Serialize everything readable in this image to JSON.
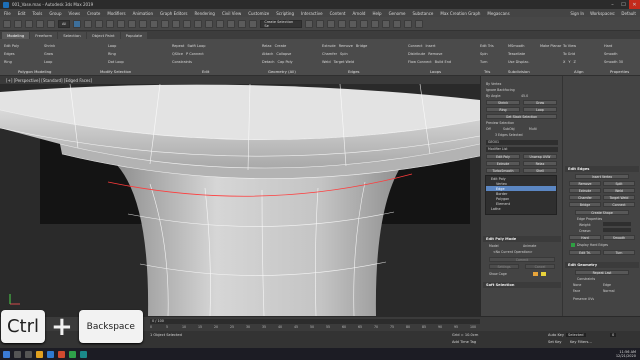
{
  "window": {
    "title": "001_Vase.max - Autodesk 3ds Max 2019",
    "min": "–",
    "max": "☐",
    "close": "✕"
  },
  "menu": {
    "items": [
      "File",
      "Edit",
      "Tools",
      "Group",
      "Views",
      "Create",
      "Modifiers",
      "Animation",
      "Graph Editors",
      "Rendering",
      "Civil View",
      "Customize",
      "Scripting",
      "Interactive",
      "Content",
      "Arnold",
      "Help",
      "Genome",
      "Substance",
      "Max Creation Graph",
      "Megascans"
    ],
    "signin": "Sign In",
    "workspaces": "Workspaces:",
    "workspace": "Default"
  },
  "toolbar": {
    "view_dd": "All",
    "create_selection_set": "Create Selection Se"
  },
  "ribbon": {
    "tabs": [
      "Modeling",
      "Freeform",
      "Selection",
      "Object Paint",
      "Populate"
    ],
    "groups": {
      "polygon_modeling": {
        "items": [
          "Edit Poly",
          "Edges",
          "Ring",
          "Loop",
          "Shrink",
          "Grow"
        ],
        "label": "Polygon Modeling"
      },
      "modify_selection": {
        "items": [
          "Loop",
          "Ring",
          "Dot Loop",
          "Ring Loop"
        ],
        "label": "Modify Selection"
      },
      "edit": {
        "items": [
          "Repeat",
          "QSlice",
          "Swift Loop",
          "Cut",
          "P Connect",
          "NURMS",
          "Constraints"
        ],
        "label": "Edit"
      },
      "geometry": {
        "items": [
          "Relax",
          "Create",
          "Attach",
          "Collapse",
          "Detach",
          "Cap Poly",
          "Quadify All"
        ],
        "label": "Geometry (All)"
      },
      "edges": {
        "items": [
          "Extrude",
          "Remove",
          "Bridge",
          "Chamfer",
          "Spin",
          "Weld",
          "Target Weld"
        ],
        "label": "Edges"
      },
      "loops": {
        "items": [
          "Connect",
          "Insert",
          "Distribute",
          "Remove",
          "Flow Connect",
          "Build End",
          "Build Corner"
        ],
        "label": "Loops"
      },
      "tris": {
        "items": [
          "Edit Tris",
          "Spin",
          "Turn"
        ],
        "label": "Tris"
      },
      "subdivision": {
        "items": [
          "MSmooth",
          "Tessellate",
          "Use Displac."
        ],
        "label": "Subdivision"
      },
      "make_planar": "Make Planar",
      "align": {
        "items": [
          "To View",
          "To Grid",
          "X",
          "Y",
          "Z"
        ],
        "label": "Align"
      },
      "properties": {
        "items": [
          "Hard",
          "Smooth",
          "Smooth 30"
        ],
        "label": "Properties"
      }
    }
  },
  "viewport": {
    "label": "[+] [Perspective] [Standard] [Edged Faces]"
  },
  "modifier_panel": {
    "sphere_backfacing": "Ignore Backfacing",
    "by_vertex": "By Vertex",
    "by_angle": "By Angle:",
    "angle_value": "45.0",
    "shrink": "Shrink",
    "grow": "Grow",
    "ring": "Ring",
    "loop": "Loop",
    "get_stack_selection": "Get Stack Selection",
    "preview_selection": "Preview Selection",
    "off": "Off",
    "subobj": "SubObj",
    "multi": "Multi",
    "edges_selected": "3 Edges Selected",
    "name": "GEO01",
    "modifier_list": "Modifier List",
    "mods": [
      "Edit Poly",
      "Extrude",
      "TurboSmooth",
      "Chamfer",
      "UVW Map",
      "Normal",
      "FFD 2x2x2"
    ],
    "mods2": [
      "Unwrap UVW",
      "Relax",
      "Shell",
      "Symmetry",
      "FFD Box",
      "Slice"
    ],
    "stack": [
      "Edit Poly",
      "Vertex",
      "Edge",
      "Border",
      "Polygon",
      "Element",
      "Lathe"
    ],
    "edit_poly_mode": "Edit Poly Mode",
    "model": "Model",
    "animate": "Animate",
    "no_current_op": "<No Current Operation>",
    "commit": "Commit",
    "settings": "Settings",
    "cancel": "Cancel",
    "show_cage": "Show Cage",
    "soft_selection": "Soft Selection"
  },
  "edit_edges": {
    "header": "Edit Edges",
    "insert_vertex": "Insert Vertex",
    "remove": "Remove",
    "split": "Split",
    "extrude": "Extrude",
    "weld": "Weld",
    "chamfer": "Chamfer",
    "target_weld": "Target Weld",
    "bridge": "Bridge",
    "connect": "Connect",
    "create_shape": "Create Shape",
    "edge_properties": "Edge Properties",
    "weight": "Weight:",
    "crease": "Crease:",
    "hard": "Hard",
    "smooth": "Smooth",
    "display_hard": "Display Hard Edges",
    "edit_tri": "Edit Tri.",
    "turn": "Turn",
    "edit_geometry": "Edit Geometry",
    "repeat_last": "Repeat Last",
    "constraints": "Constraints",
    "none": "None",
    "edge": "Edge",
    "face": "Face",
    "normal": "Normal",
    "preserve_uvs": "Preserve UVs"
  },
  "timeline": {
    "ticks": [
      "0",
      "5",
      "10",
      "15",
      "20",
      "25",
      "30",
      "35",
      "40",
      "45",
      "50",
      "55",
      "60",
      "65",
      "70",
      "75",
      "80",
      "85",
      "90",
      "95",
      "100"
    ],
    "frame": "0 / 100"
  },
  "status": {
    "selected": "1 Object Selected",
    "grid": "Grid = 10.0cm",
    "add_time_tag": "Add Time Tag",
    "auto_key": "Auto Key",
    "selected_dd": "Selected",
    "set_key": "Set Key",
    "key_filters": "Key Filters...",
    "frame_value": "0"
  },
  "keys": {
    "ctrl": "Ctrl",
    "plus": "+",
    "backspace": "Backspace"
  },
  "taskbar": {
    "time": "11:56 AM",
    "date": "12/21/2020"
  }
}
